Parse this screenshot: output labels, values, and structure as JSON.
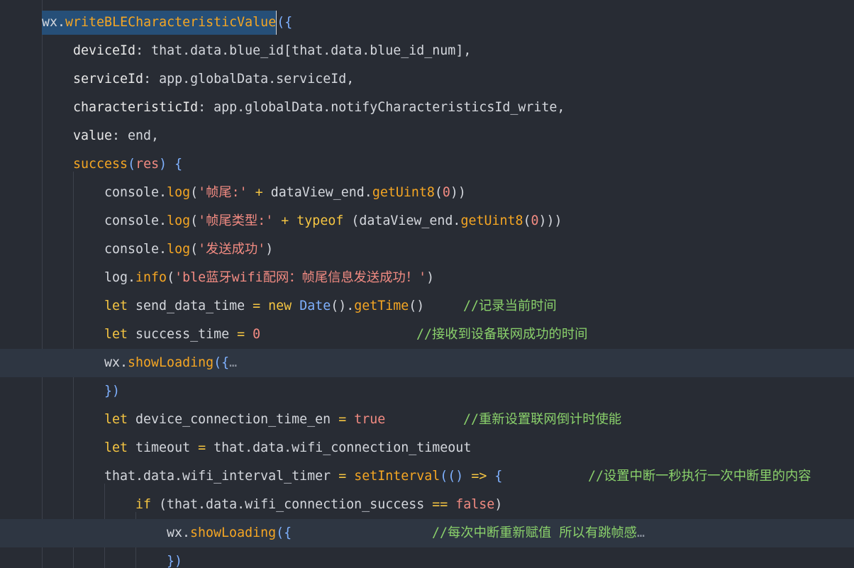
{
  "editor": {
    "lines": [
      {
        "text_a": "wx.",
        "text_b": "writeBLECharacteristicValue",
        "text_c": "({"
      },
      {
        "key": "deviceId",
        "rest": ": that.data.blue_id[that.data.blue_id_num],"
      },
      {
        "key": "serviceId",
        "rest": ": app.globalData.serviceId,"
      },
      {
        "key": "characteristicId",
        "rest": ": app.globalData.notifyCharacteristicsId_write,"
      },
      {
        "key": "value",
        "rest": ": end,"
      },
      {
        "fn": "success",
        "p1": "(",
        "param": "res",
        "p2": ") {"
      },
      {
        "a": "console.",
        "fn": "log",
        "b": "(",
        "str": "'帧尾:'",
        "op": " + ",
        "c": "dataView_end.",
        "fn2": "getUint8",
        "d": "(",
        "num": "0",
        "e": "))"
      },
      {
        "a": "console.",
        "fn": "log",
        "b": "(",
        "str": "'帧尾类型:'",
        "op": " + ",
        "kw": "typeof",
        "c": " (dataView_end.",
        "fn2": "getUint8",
        "d": "(",
        "num": "0",
        "e": ")))"
      },
      {
        "a": "console.",
        "fn": "log",
        "b": "(",
        "str": "'发送成功'",
        "e": ")"
      },
      {
        "a": "log.",
        "fn": "info",
        "b": "(",
        "str": "'ble蓝牙wifi配网：帧尾信息发送成功！'",
        "e": ")"
      },
      {
        "kw": "let",
        "a": " send_data_time ",
        "op": "=",
        "kw2": " new ",
        "cls": "Date",
        "b": "().",
        "fn": "getTime",
        "c": "()",
        "cmt": "//记录当前时间"
      },
      {
        "kw": "let",
        "a": " success_time ",
        "op": "=",
        "num": " 0",
        "cmt": "//接收到设备联网成功的时间"
      },
      {
        "a": "wx.",
        "fn": "showLoading",
        "b": "({",
        "fold": "…"
      },
      {
        "a": "})"
      },
      {
        "kw": "let",
        "a": " device_connection_time_en ",
        "op": "=",
        "bool": " true",
        "cmt": "//重新设置联网倒计时使能"
      },
      {
        "kw": "let",
        "a": " timeout ",
        "op": "=",
        "b": " that.data.wifi_connection_timeout"
      },
      {
        "a": "that.data.wifi_interval_timer ",
        "op": "=",
        "fn": " setInterval",
        "b": "(() ",
        "op2": "=>",
        "c": " {",
        "cmt": "//设置中断一秒执行一次中断里的内容"
      },
      {
        "kw": "if",
        "a": " (that.data.wifi_connection_success ",
        "op": "==",
        "bool": " false",
        "b": ")"
      },
      {
        "a": "wx.",
        "fn": "showLoading",
        "b": "({",
        "cmt": "//每次中断重新赋值 所以有跳帧感",
        "fold": "…"
      },
      {
        "a": "})"
      }
    ]
  }
}
